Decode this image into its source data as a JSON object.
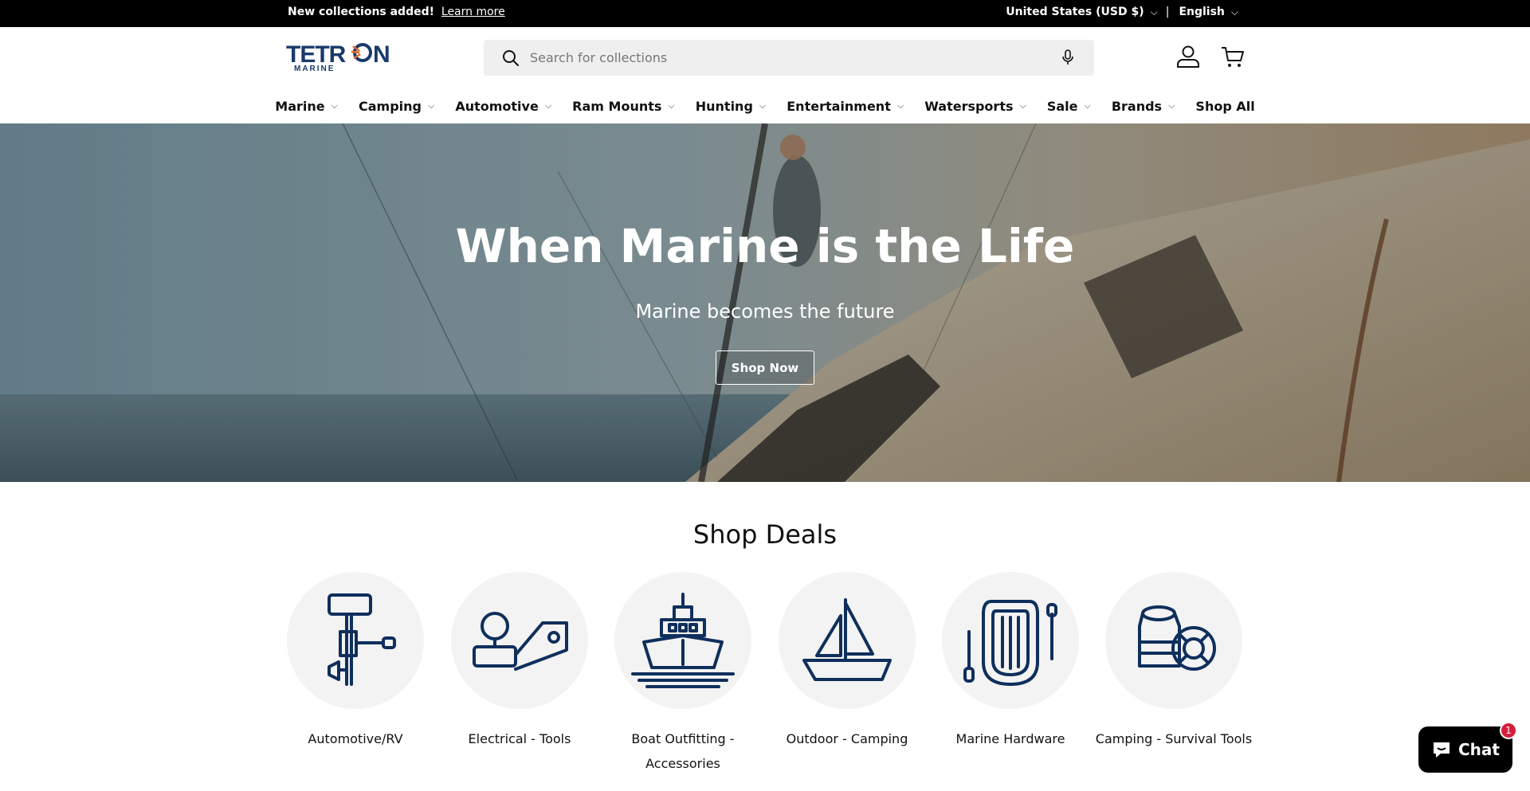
{
  "announcement": {
    "message": "New collections added!",
    "link_label": "Learn more",
    "country": "United States (USD $)",
    "separator": "|",
    "language": "English"
  },
  "header": {
    "logo_text": "TETRON",
    "logo_subtext": "MARINE",
    "search_placeholder": "Search for collections",
    "icons": [
      "search-icon",
      "microphone-icon",
      "account-icon",
      "cart-icon"
    ]
  },
  "nav": {
    "items": [
      {
        "label": "Marine",
        "has_dropdown": true
      },
      {
        "label": "Camping",
        "has_dropdown": true
      },
      {
        "label": "Automotive",
        "has_dropdown": true
      },
      {
        "label": "Ram Mounts",
        "has_dropdown": true
      },
      {
        "label": "Hunting",
        "has_dropdown": true
      },
      {
        "label": "Entertainment",
        "has_dropdown": true
      },
      {
        "label": "Watersports",
        "has_dropdown": true
      },
      {
        "label": "Sale",
        "has_dropdown": true
      },
      {
        "label": "Brands",
        "has_dropdown": true
      },
      {
        "label": "Shop All",
        "has_dropdown": false
      }
    ]
  },
  "hero": {
    "title": "When Marine is the Life",
    "subtitle": "Marine becomes the future",
    "button_label": "Shop Now"
  },
  "deals": {
    "title": "Shop Deals",
    "categories": [
      {
        "label": "Automotive/RV",
        "icon": "outboard-motor-icon"
      },
      {
        "label": "Electrical - Tools",
        "icon": "trailer-hitch-icon"
      },
      {
        "label": "Boat Outfitting - Accessories",
        "icon": "ship-icon"
      },
      {
        "label": "Outdoor - Camping",
        "icon": "sailboat-icon"
      },
      {
        "label": "Marine Hardware",
        "icon": "inflatable-boat-icon"
      },
      {
        "label": "Camping - Survival Tools",
        "icon": "life-ring-icon"
      }
    ]
  },
  "chat": {
    "label": "Chat",
    "badge_count": "1"
  },
  "colors": {
    "brand_navy": "#1a3a6b",
    "brand_orange": "#e8672a",
    "icon_navy": "#0f2f5c",
    "announcement_bg": "#000000",
    "chat_badge": "#d41e3a"
  }
}
